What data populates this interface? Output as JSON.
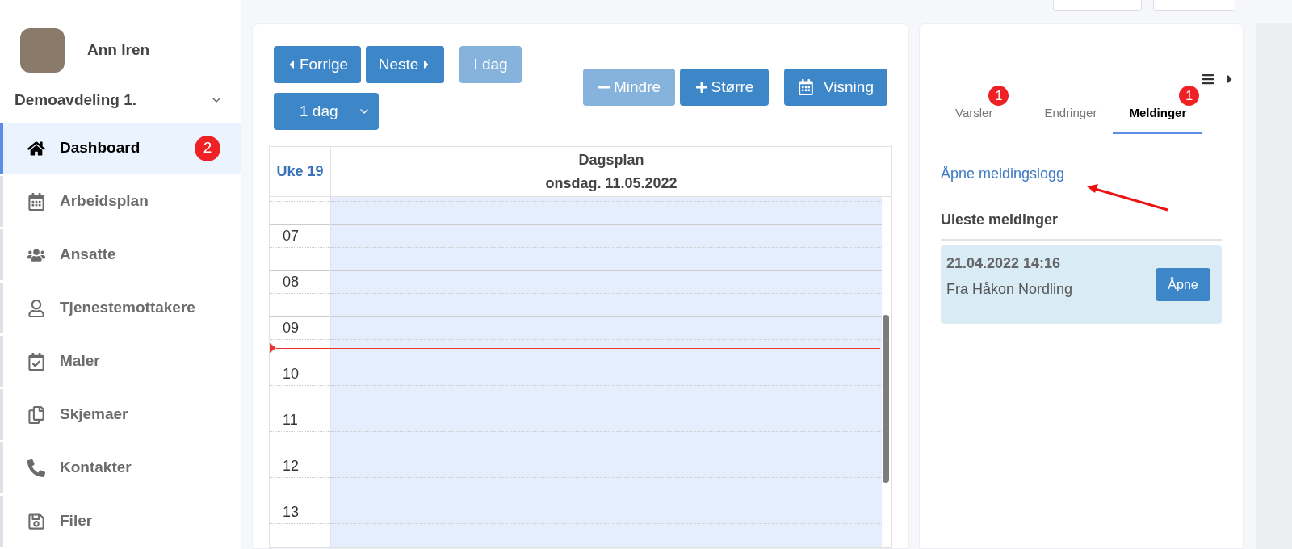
{
  "user": {
    "name": "Ann Iren"
  },
  "department": {
    "label": "Demoavdeling 1."
  },
  "nav": [
    {
      "kind": "home",
      "label": "Dashboard",
      "selected": true,
      "badge": "2"
    },
    {
      "kind": "calendar",
      "label": "Arbeidsplan",
      "selected": false
    },
    {
      "kind": "users",
      "label": "Ansatte",
      "selected": false
    },
    {
      "kind": "user",
      "label": "Tjenestemottakere",
      "selected": false
    },
    {
      "kind": "calendar-check",
      "label": "Maler",
      "selected": false
    },
    {
      "kind": "copy",
      "label": "Skjemaer",
      "selected": false
    },
    {
      "kind": "phone",
      "label": "Kontakter",
      "selected": false
    },
    {
      "kind": "save",
      "label": "Filer",
      "selected": false
    }
  ],
  "toolbar": {
    "prev": {
      "label": "Forrige",
      "disabled": false
    },
    "next": {
      "label": "Neste",
      "disabled": false
    },
    "today": {
      "label": "I dag",
      "disabled": true
    },
    "range": {
      "value": "1 dag"
    },
    "smaller": {
      "label": "Mindre",
      "disabled": true
    },
    "larger": {
      "label": "Større",
      "disabled": false
    },
    "view": {
      "label": "Visning"
    }
  },
  "calendar": {
    "week": "Uke 19",
    "title": "Dagsplan",
    "date": "onsdag. 11.05.2022",
    "hours": [
      "07",
      "08",
      "09",
      "10",
      "11",
      "12",
      "13"
    ]
  },
  "panel": {
    "tabs": [
      {
        "label": "Varsler",
        "selected": false,
        "badge": "1"
      },
      {
        "label": "Endringer",
        "selected": false
      },
      {
        "label": "Meldinger",
        "selected": true,
        "badge": "1"
      }
    ],
    "link": "Åpne meldingslogg",
    "heading": "Uleste meldinger",
    "messages": [
      {
        "time": "21.04.2022 14:16",
        "from": "Fra Håkon Nordling",
        "button": "Åpne"
      }
    ]
  }
}
